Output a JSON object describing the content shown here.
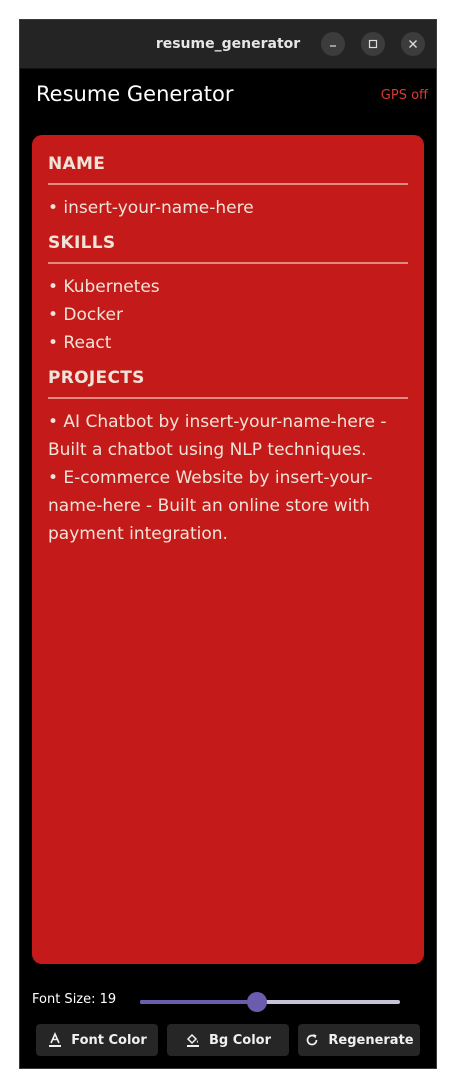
{
  "window": {
    "title": "resume_generator",
    "controls": [
      "minimize-icon",
      "maximize-icon",
      "close-icon"
    ]
  },
  "appbar": {
    "title": "Resume Generator",
    "gps_status": "GPS off",
    "gps_color": "#d83a34"
  },
  "resume": {
    "background_color": "#c41a1a",
    "font_color": "#f0e4d8",
    "sections": [
      {
        "heading": "NAME",
        "lines": [
          "• insert-your-name-here"
        ]
      },
      {
        "heading": "SKILLS",
        "lines": [
          "• Kubernetes",
          "• Docker",
          "• React"
        ]
      },
      {
        "heading": "PROJECTS",
        "lines": [
          "• AI Chatbot by insert-your-name-here -",
          "Built a chatbot using NLP techniques.",
          "• E-commerce Website by insert-your-",
          "name-here - Built an online store with",
          "payment integration."
        ]
      }
    ]
  },
  "controls": {
    "font_size_label": "Font Size: 19",
    "font_size_value": 19,
    "slider_fraction": 0.45,
    "slider_color": "#6b5cad",
    "buttons": {
      "font_color": {
        "label": "Font Color",
        "icon": "text-color-icon"
      },
      "bg_color": {
        "label": "Bg Color",
        "icon": "paint-bucket-icon"
      },
      "regenerate": {
        "label": "Regenerate",
        "icon": "refresh-icon"
      }
    }
  }
}
